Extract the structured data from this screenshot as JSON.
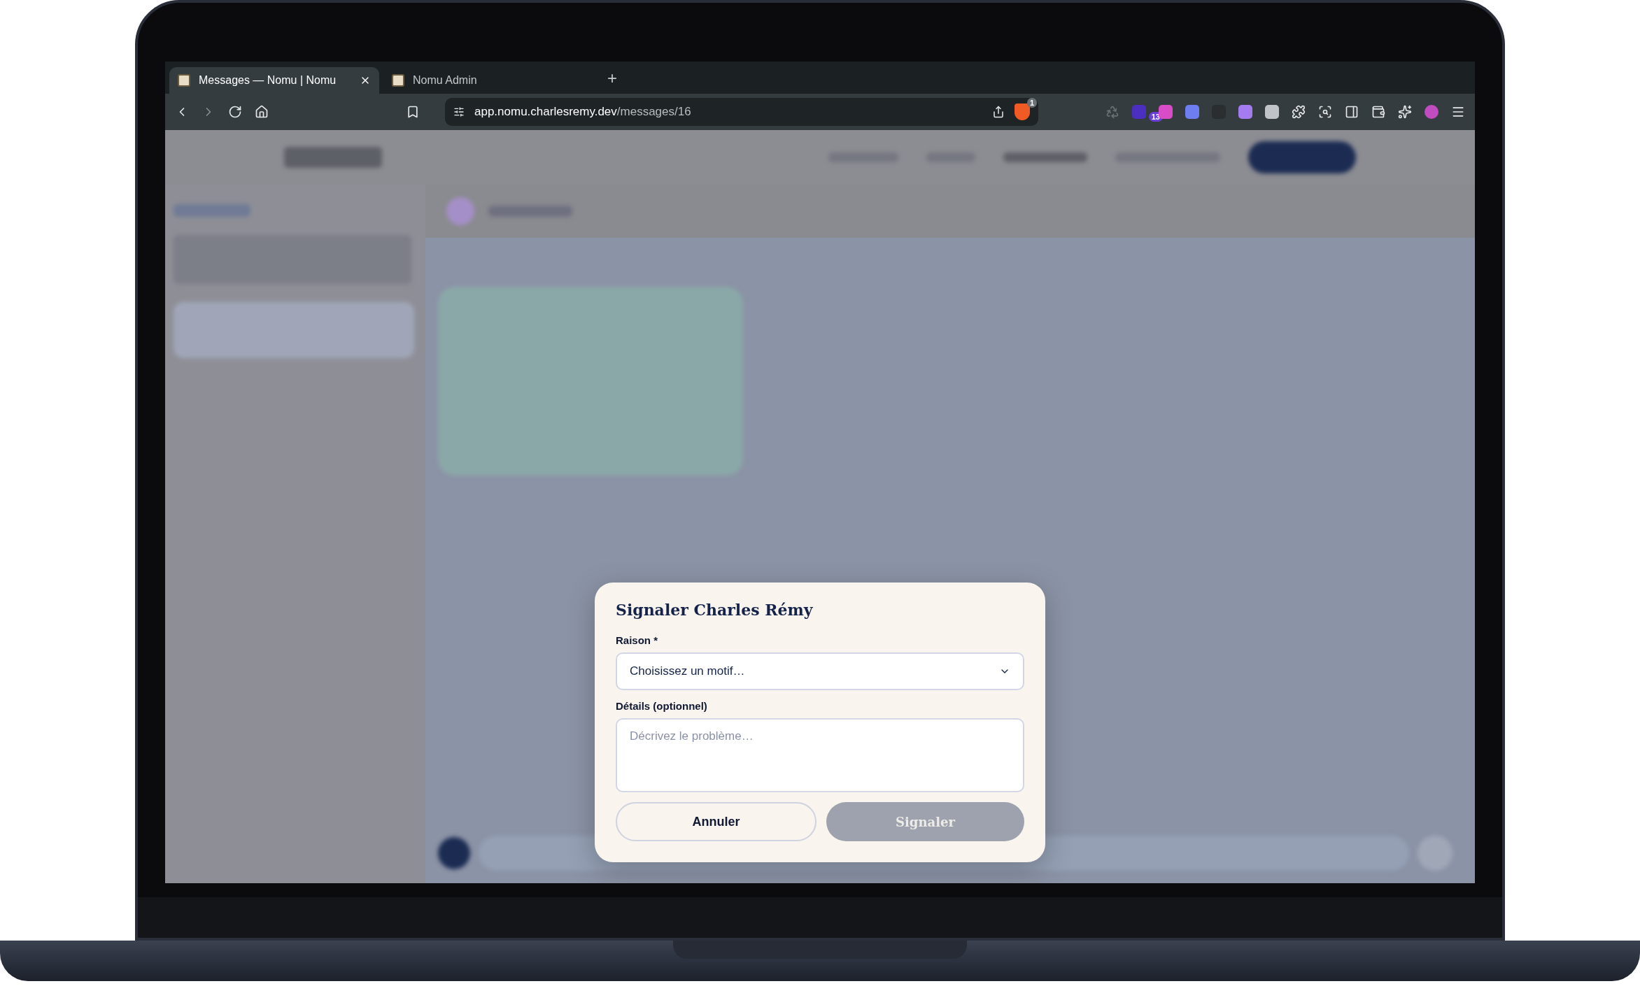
{
  "browser": {
    "tabs": [
      {
        "title": "Messages — Nomu | Nomu",
        "selected": true
      },
      {
        "title": "Nomu Admin",
        "selected": false
      }
    ],
    "new_tab": "+",
    "url": {
      "host": "app.nomu.charlesremy.dev",
      "path": "/messages/16"
    },
    "shield_badge": "1",
    "extension_badge": "13"
  },
  "dialog": {
    "title": "Signaler Charles Rémy",
    "reason_label": "Raison *",
    "reason_value": "Choisissez un motif…",
    "details_label": "Détails (optionnel)",
    "details_placeholder": "Décrivez le problème…",
    "buttons": [
      {
        "label": "Annuler",
        "kind": "secondary",
        "disabled": false
      },
      {
        "label": "Signaler",
        "kind": "primary",
        "disabled": true
      }
    ]
  }
}
